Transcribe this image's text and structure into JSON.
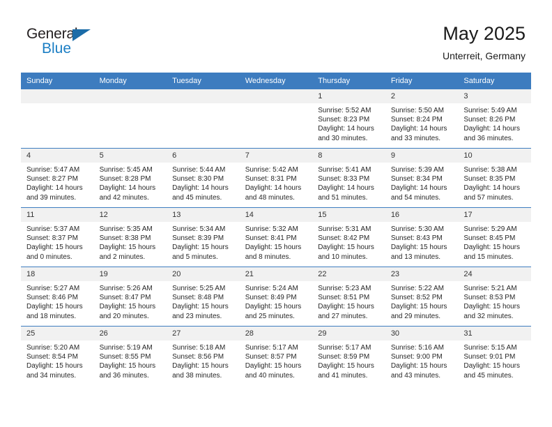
{
  "brand": {
    "line1": "General",
    "line2": "Blue",
    "triangle_color": "#1b6ca8",
    "line2_color": "#1b7ec4"
  },
  "header": {
    "title": "May 2025",
    "subtitle": "Unterreit, Germany"
  },
  "colors": {
    "header_blue": "#3d7cbf",
    "daynum_band": "#f1f1f1",
    "text": "#262626"
  },
  "weekday_headers": [
    "Sunday",
    "Monday",
    "Tuesday",
    "Wednesday",
    "Thursday",
    "Friday",
    "Saturday"
  ],
  "weeks": [
    [
      {
        "day": "",
        "sunrise": "",
        "sunset": "",
        "daylight_line1": "",
        "daylight_line2": ""
      },
      {
        "day": "",
        "sunrise": "",
        "sunset": "",
        "daylight_line1": "",
        "daylight_line2": ""
      },
      {
        "day": "",
        "sunrise": "",
        "sunset": "",
        "daylight_line1": "",
        "daylight_line2": ""
      },
      {
        "day": "",
        "sunrise": "",
        "sunset": "",
        "daylight_line1": "",
        "daylight_line2": ""
      },
      {
        "day": "1",
        "sunrise": "Sunrise: 5:52 AM",
        "sunset": "Sunset: 8:23 PM",
        "daylight_line1": "Daylight: 14 hours",
        "daylight_line2": "and 30 minutes."
      },
      {
        "day": "2",
        "sunrise": "Sunrise: 5:50 AM",
        "sunset": "Sunset: 8:24 PM",
        "daylight_line1": "Daylight: 14 hours",
        "daylight_line2": "and 33 minutes."
      },
      {
        "day": "3",
        "sunrise": "Sunrise: 5:49 AM",
        "sunset": "Sunset: 8:26 PM",
        "daylight_line1": "Daylight: 14 hours",
        "daylight_line2": "and 36 minutes."
      }
    ],
    [
      {
        "day": "4",
        "sunrise": "Sunrise: 5:47 AM",
        "sunset": "Sunset: 8:27 PM",
        "daylight_line1": "Daylight: 14 hours",
        "daylight_line2": "and 39 minutes."
      },
      {
        "day": "5",
        "sunrise": "Sunrise: 5:45 AM",
        "sunset": "Sunset: 8:28 PM",
        "daylight_line1": "Daylight: 14 hours",
        "daylight_line2": "and 42 minutes."
      },
      {
        "day": "6",
        "sunrise": "Sunrise: 5:44 AM",
        "sunset": "Sunset: 8:30 PM",
        "daylight_line1": "Daylight: 14 hours",
        "daylight_line2": "and 45 minutes."
      },
      {
        "day": "7",
        "sunrise": "Sunrise: 5:42 AM",
        "sunset": "Sunset: 8:31 PM",
        "daylight_line1": "Daylight: 14 hours",
        "daylight_line2": "and 48 minutes."
      },
      {
        "day": "8",
        "sunrise": "Sunrise: 5:41 AM",
        "sunset": "Sunset: 8:33 PM",
        "daylight_line1": "Daylight: 14 hours",
        "daylight_line2": "and 51 minutes."
      },
      {
        "day": "9",
        "sunrise": "Sunrise: 5:39 AM",
        "sunset": "Sunset: 8:34 PM",
        "daylight_line1": "Daylight: 14 hours",
        "daylight_line2": "and 54 minutes."
      },
      {
        "day": "10",
        "sunrise": "Sunrise: 5:38 AM",
        "sunset": "Sunset: 8:35 PM",
        "daylight_line1": "Daylight: 14 hours",
        "daylight_line2": "and 57 minutes."
      }
    ],
    [
      {
        "day": "11",
        "sunrise": "Sunrise: 5:37 AM",
        "sunset": "Sunset: 8:37 PM",
        "daylight_line1": "Daylight: 15 hours",
        "daylight_line2": "and 0 minutes."
      },
      {
        "day": "12",
        "sunrise": "Sunrise: 5:35 AM",
        "sunset": "Sunset: 8:38 PM",
        "daylight_line1": "Daylight: 15 hours",
        "daylight_line2": "and 2 minutes."
      },
      {
        "day": "13",
        "sunrise": "Sunrise: 5:34 AM",
        "sunset": "Sunset: 8:39 PM",
        "daylight_line1": "Daylight: 15 hours",
        "daylight_line2": "and 5 minutes."
      },
      {
        "day": "14",
        "sunrise": "Sunrise: 5:32 AM",
        "sunset": "Sunset: 8:41 PM",
        "daylight_line1": "Daylight: 15 hours",
        "daylight_line2": "and 8 minutes."
      },
      {
        "day": "15",
        "sunrise": "Sunrise: 5:31 AM",
        "sunset": "Sunset: 8:42 PM",
        "daylight_line1": "Daylight: 15 hours",
        "daylight_line2": "and 10 minutes."
      },
      {
        "day": "16",
        "sunrise": "Sunrise: 5:30 AM",
        "sunset": "Sunset: 8:43 PM",
        "daylight_line1": "Daylight: 15 hours",
        "daylight_line2": "and 13 minutes."
      },
      {
        "day": "17",
        "sunrise": "Sunrise: 5:29 AM",
        "sunset": "Sunset: 8:45 PM",
        "daylight_line1": "Daylight: 15 hours",
        "daylight_line2": "and 15 minutes."
      }
    ],
    [
      {
        "day": "18",
        "sunrise": "Sunrise: 5:27 AM",
        "sunset": "Sunset: 8:46 PM",
        "daylight_line1": "Daylight: 15 hours",
        "daylight_line2": "and 18 minutes."
      },
      {
        "day": "19",
        "sunrise": "Sunrise: 5:26 AM",
        "sunset": "Sunset: 8:47 PM",
        "daylight_line1": "Daylight: 15 hours",
        "daylight_line2": "and 20 minutes."
      },
      {
        "day": "20",
        "sunrise": "Sunrise: 5:25 AM",
        "sunset": "Sunset: 8:48 PM",
        "daylight_line1": "Daylight: 15 hours",
        "daylight_line2": "and 23 minutes."
      },
      {
        "day": "21",
        "sunrise": "Sunrise: 5:24 AM",
        "sunset": "Sunset: 8:49 PM",
        "daylight_line1": "Daylight: 15 hours",
        "daylight_line2": "and 25 minutes."
      },
      {
        "day": "22",
        "sunrise": "Sunrise: 5:23 AM",
        "sunset": "Sunset: 8:51 PM",
        "daylight_line1": "Daylight: 15 hours",
        "daylight_line2": "and 27 minutes."
      },
      {
        "day": "23",
        "sunrise": "Sunrise: 5:22 AM",
        "sunset": "Sunset: 8:52 PM",
        "daylight_line1": "Daylight: 15 hours",
        "daylight_line2": "and 29 minutes."
      },
      {
        "day": "24",
        "sunrise": "Sunrise: 5:21 AM",
        "sunset": "Sunset: 8:53 PM",
        "daylight_line1": "Daylight: 15 hours",
        "daylight_line2": "and 32 minutes."
      }
    ],
    [
      {
        "day": "25",
        "sunrise": "Sunrise: 5:20 AM",
        "sunset": "Sunset: 8:54 PM",
        "daylight_line1": "Daylight: 15 hours",
        "daylight_line2": "and 34 minutes."
      },
      {
        "day": "26",
        "sunrise": "Sunrise: 5:19 AM",
        "sunset": "Sunset: 8:55 PM",
        "daylight_line1": "Daylight: 15 hours",
        "daylight_line2": "and 36 minutes."
      },
      {
        "day": "27",
        "sunrise": "Sunrise: 5:18 AM",
        "sunset": "Sunset: 8:56 PM",
        "daylight_line1": "Daylight: 15 hours",
        "daylight_line2": "and 38 minutes."
      },
      {
        "day": "28",
        "sunrise": "Sunrise: 5:17 AM",
        "sunset": "Sunset: 8:57 PM",
        "daylight_line1": "Daylight: 15 hours",
        "daylight_line2": "and 40 minutes."
      },
      {
        "day": "29",
        "sunrise": "Sunrise: 5:17 AM",
        "sunset": "Sunset: 8:59 PM",
        "daylight_line1": "Daylight: 15 hours",
        "daylight_line2": "and 41 minutes."
      },
      {
        "day": "30",
        "sunrise": "Sunrise: 5:16 AM",
        "sunset": "Sunset: 9:00 PM",
        "daylight_line1": "Daylight: 15 hours",
        "daylight_line2": "and 43 minutes."
      },
      {
        "day": "31",
        "sunrise": "Sunrise: 5:15 AM",
        "sunset": "Sunset: 9:01 PM",
        "daylight_line1": "Daylight: 15 hours",
        "daylight_line2": "and 45 minutes."
      }
    ]
  ]
}
